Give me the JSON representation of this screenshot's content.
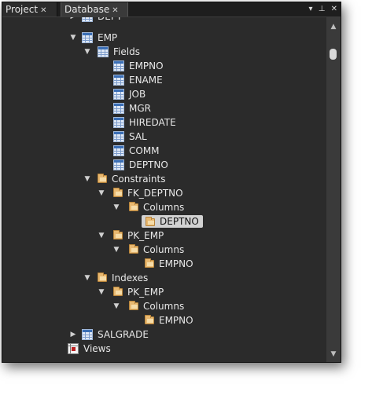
{
  "tabs": {
    "project": {
      "label": "Project",
      "close": "✕"
    },
    "database": {
      "label": "Database",
      "close": "✕"
    }
  },
  "tab_tools": {
    "menu": "▾",
    "pin": "⊥",
    "close": "✕"
  },
  "tree": {
    "dept": "DEPT",
    "emp": "EMP",
    "fields": "Fields",
    "field_items": [
      "EMPNO",
      "ENAME",
      "JOB",
      "MGR",
      "HIREDATE",
      "SAL",
      "COMM",
      "DEPTNO"
    ],
    "constraints": "Constraints",
    "fk_deptno": "FK_DEPTNO",
    "fk_columns": "Columns",
    "fk_column_item": "DEPTNO",
    "pk_emp": "PK_EMP",
    "pk_columns": "Columns",
    "pk_column_item": "EMPNO",
    "indexes": "Indexes",
    "idx_pk_emp": "PK_EMP",
    "idx_columns": "Columns",
    "idx_column_item": "EMPNO",
    "salgrade": "SALGRADE",
    "views": "Views"
  },
  "icons": {
    "expanded": "expanded-arrow-icon",
    "collapsed": "collapsed-arrow-icon",
    "table": "table-icon",
    "field": "field-icon",
    "folder": "folder-icon",
    "views": "views-icon"
  },
  "colors": {
    "panel_bg": "#2b2b2b",
    "text": "#e8e8e8",
    "selection_bg": "#d2d2d2",
    "folder": "#e8b870",
    "table_icon": "#3b6fb6"
  }
}
